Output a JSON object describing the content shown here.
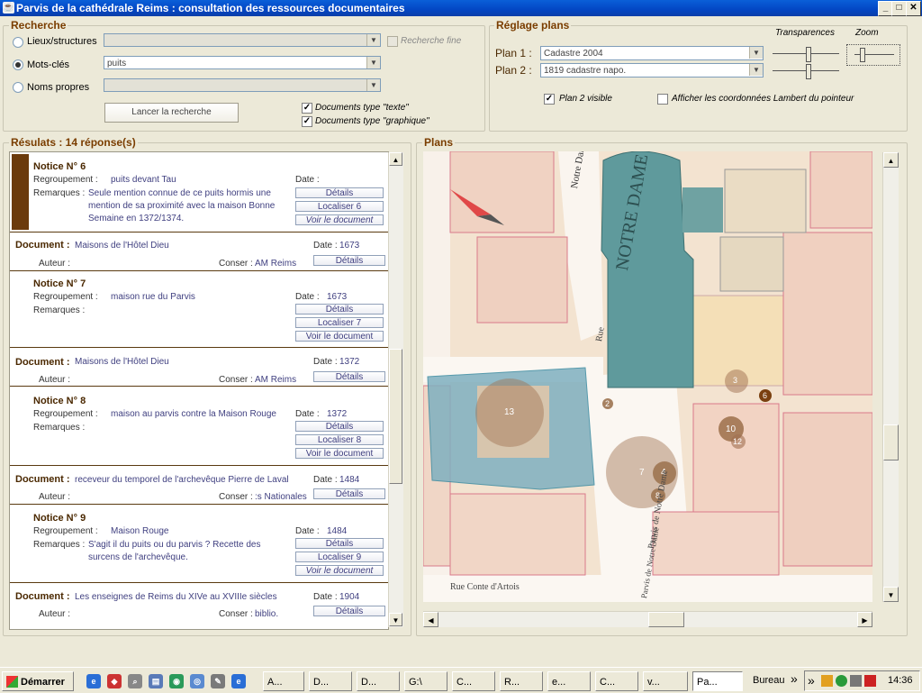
{
  "window": {
    "title": "Parvis de la cathédrale Reims : consultation des ressources documentaires",
    "buttons": [
      "_",
      "□",
      "✕"
    ]
  },
  "recherche": {
    "title": "Recherche",
    "lieux_label": "Lieux/structures",
    "motscles_label": "Mots-clés",
    "motscles_value": "puits",
    "noms_label": "Noms propres",
    "fine_label": "Recherche fine",
    "search_button": "Lancer la recherche",
    "doc_texte": "Documents type \"texte\"",
    "doc_graphique": "Documents type \"graphique\""
  },
  "plans": {
    "title": "Réglage plans",
    "plan1_label": "Plan 1 :",
    "plan1_value": "Cadastre 2004",
    "plan2_label": "Plan 2 :",
    "plan2_value": "1819 cadastre napo.",
    "transparences": "Transparences",
    "zoom": "Zoom",
    "plan2_visible": "Plan 2 visible",
    "lambert": "Afficher les coordonnées Lambert du pointeur"
  },
  "results": {
    "title": "Résulats : 14 réponse(s)",
    "labels": {
      "regroupement": "Regroupement  :",
      "remarques": "Remarques :",
      "date": "Date :",
      "auteur": "Auteur :",
      "conser": "Conser :",
      "document": "Document :"
    },
    "buttons": {
      "details": "Détails",
      "voir": "Voir le document"
    },
    "n6": {
      "title": "Notice N° 6",
      "regroupement": "puits devant Tau",
      "date": "",
      "rem1": "Seule mention connue de ce puits hormis une",
      "rem2": "mention de sa proximité avec la maison Bonne",
      "rem3": "Semaine en 1372/1374.",
      "localiser": "Localiser 6"
    },
    "d1": {
      "title": "Maisons de l'Hôtel Dieu",
      "date": "1673",
      "conser": "AM Reims"
    },
    "n7": {
      "title": "Notice N° 7",
      "regroupement": "maison rue du Parvis",
      "date": "1673",
      "localiser": "Localiser 7"
    },
    "d2": {
      "title": "Maisons de l'Hôtel Dieu",
      "date": "1372",
      "conser": "AM Reims"
    },
    "n8": {
      "title": "Notice N° 8",
      "regroupement": "maison au parvis contre la Maison Rouge",
      "date": "1372",
      "localiser": "Localiser 8"
    },
    "d3": {
      "title": "receveur du temporel de l'archevêque Pierre de Laval",
      "date": "1484",
      "conser": ":s Nationales"
    },
    "n9": {
      "title": "Notice N° 9",
      "regroupement": "Maison Rouge",
      "date": "1484",
      "rem1": "S'agit il du puits ou du parvis ? Recette des",
      "rem2": "surcens de l'archevêque.",
      "localiser": "Localiser 9"
    },
    "d4": {
      "title": "Les enseignes de Reims du XIVe au XVIIIe siècles",
      "date": "1904",
      "conser": "biblio."
    }
  },
  "map": {
    "title": "Plans",
    "markers": [
      "13",
      "2",
      "3",
      "6",
      "10",
      "12",
      "7",
      "4",
      "8"
    ],
    "labels": {
      "notre_dame": "Notre Dame",
      "notre_dame_big": "NOTRE DAME",
      "rue": "Rue",
      "parvis": "Parvis de Notre Dame",
      "parvis2": "Parvis de Notre Dame",
      "rue_bottom": "Rue  Conte d'Artois"
    }
  },
  "taskbar": {
    "start": "Démarrer",
    "items": [
      "A...",
      "D...",
      "D...",
      "G:\\",
      "C...",
      "R...",
      "e...",
      "C...",
      "v...",
      "Pa..."
    ],
    "bureau": "Bureau",
    "chevrons": "»",
    "clock": "14:36"
  },
  "colors": {
    "accent_brown": "#7a3d00",
    "title_blue": "#0346c4"
  }
}
